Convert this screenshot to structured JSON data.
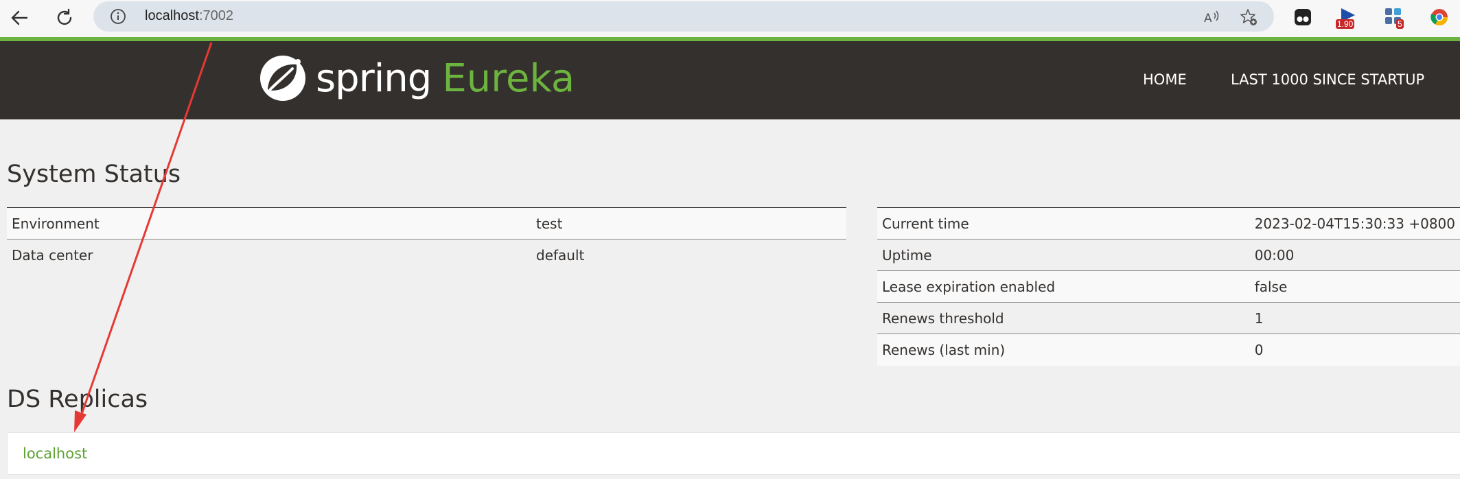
{
  "browser": {
    "url_host": "localhost",
    "url_port": ":7002",
    "extensions": [
      {
        "name": "tampermonkey",
        "badge": ""
      },
      {
        "name": "speed-extension",
        "badge": "1.90"
      },
      {
        "name": "apps-extension",
        "badge": "5"
      },
      {
        "name": "chrome-extension",
        "badge": ""
      }
    ]
  },
  "header": {
    "logo_spring": "spring",
    "logo_eureka": "Eureka",
    "nav": {
      "home": "HOME",
      "last": "LAST 1000 SINCE STARTUP"
    }
  },
  "system_status": {
    "title": "System Status",
    "left_table": [
      {
        "label": "Environment",
        "value": "test"
      },
      {
        "label": "Data center",
        "value": "default"
      }
    ],
    "right_table": [
      {
        "label": "Current time",
        "value": "2023-02-04T15:30:33 +0800"
      },
      {
        "label": "Uptime",
        "value": "00:00"
      },
      {
        "label": "Lease expiration enabled",
        "value": "false"
      },
      {
        "label": "Renews threshold",
        "value": "1"
      },
      {
        "label": "Renews (last min)",
        "value": "0"
      }
    ]
  },
  "ds_replicas": {
    "title": "DS Replicas",
    "items": [
      "localhost"
    ]
  },
  "colors": {
    "brand_green": "#6db33f",
    "header_bg": "#34302d",
    "annotation_arrow": "#e53935"
  }
}
